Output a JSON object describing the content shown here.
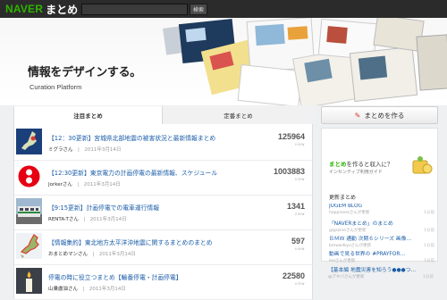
{
  "header": {
    "logo_naver": "NAVER",
    "logo_matome": "まとめ",
    "search_placeholder": "",
    "search_button": "検索"
  },
  "hero": {
    "tagline": "情報をデザインする。",
    "subline": "Curation Platform"
  },
  "tabs": [
    "注目まとめ",
    "定番まとめ"
  ],
  "items": [
    {
      "title": "【12：30更新】宮城県北部地震の被害状況と最新情報まとめ",
      "author": "ミグラさん",
      "date": "2011年3月14日",
      "views": "125964",
      "view_label": "view"
    },
    {
      "title": "【12:30更新】東京電力の計画停電の最新情報、スケジュール",
      "author": "Jorkerさん",
      "date": "2011年3月14日",
      "views": "1003883",
      "view_label": "view"
    },
    {
      "title": "【9:15更新】計画停電での電車運行情報",
      "author": "RENTA-Tさん",
      "date": "2011年3月14日",
      "views": "1341",
      "view_label": "view"
    },
    {
      "title": "【情報集約】東北地方太平洋沖地震に関するまとめのまとめ",
      "author": "おまとめマンさん",
      "date": "2011年3月14日",
      "views": "597",
      "view_label": "view"
    },
    {
      "title": "停電の時に役立つまとめ【輪番停電・計画停電】",
      "author": "山乗盧油さん",
      "date": "2011年3月14日",
      "views": "22580",
      "view_label": "view"
    }
  ],
  "sidebar": {
    "create_button": "まとめを作る",
    "promo_brand": "まとめ",
    "promo_title_rest": "を作ると収入に？",
    "promo_sub": "インセンティブ利用ガイド",
    "latest_heading": "更新まとめ",
    "latest": [
      {
        "title": "JUGEM BLOG",
        "meta": "happinessさんが更新",
        "ago": "1分前"
      },
      {
        "title": "「NAVERまとめ」のまとめ",
        "meta": "gigazineさんが更新",
        "ago": "1分前"
      },
      {
        "title": "ＢＭＷ 通勤 次期６シリーズ 画像…",
        "meta": "bmwwilkysさんが更新",
        "ago": "1分前"
      },
      {
        "title": "動画で見る世界の #PRAYFOR…",
        "meta": "leeさんが更新",
        "ago": "1分前"
      },
      {
        "title": "【基本編 地震災害を知ろう●●●つ…",
        "meta": "@アキバさんが更新",
        "ago": "1分前"
      }
    ]
  }
}
